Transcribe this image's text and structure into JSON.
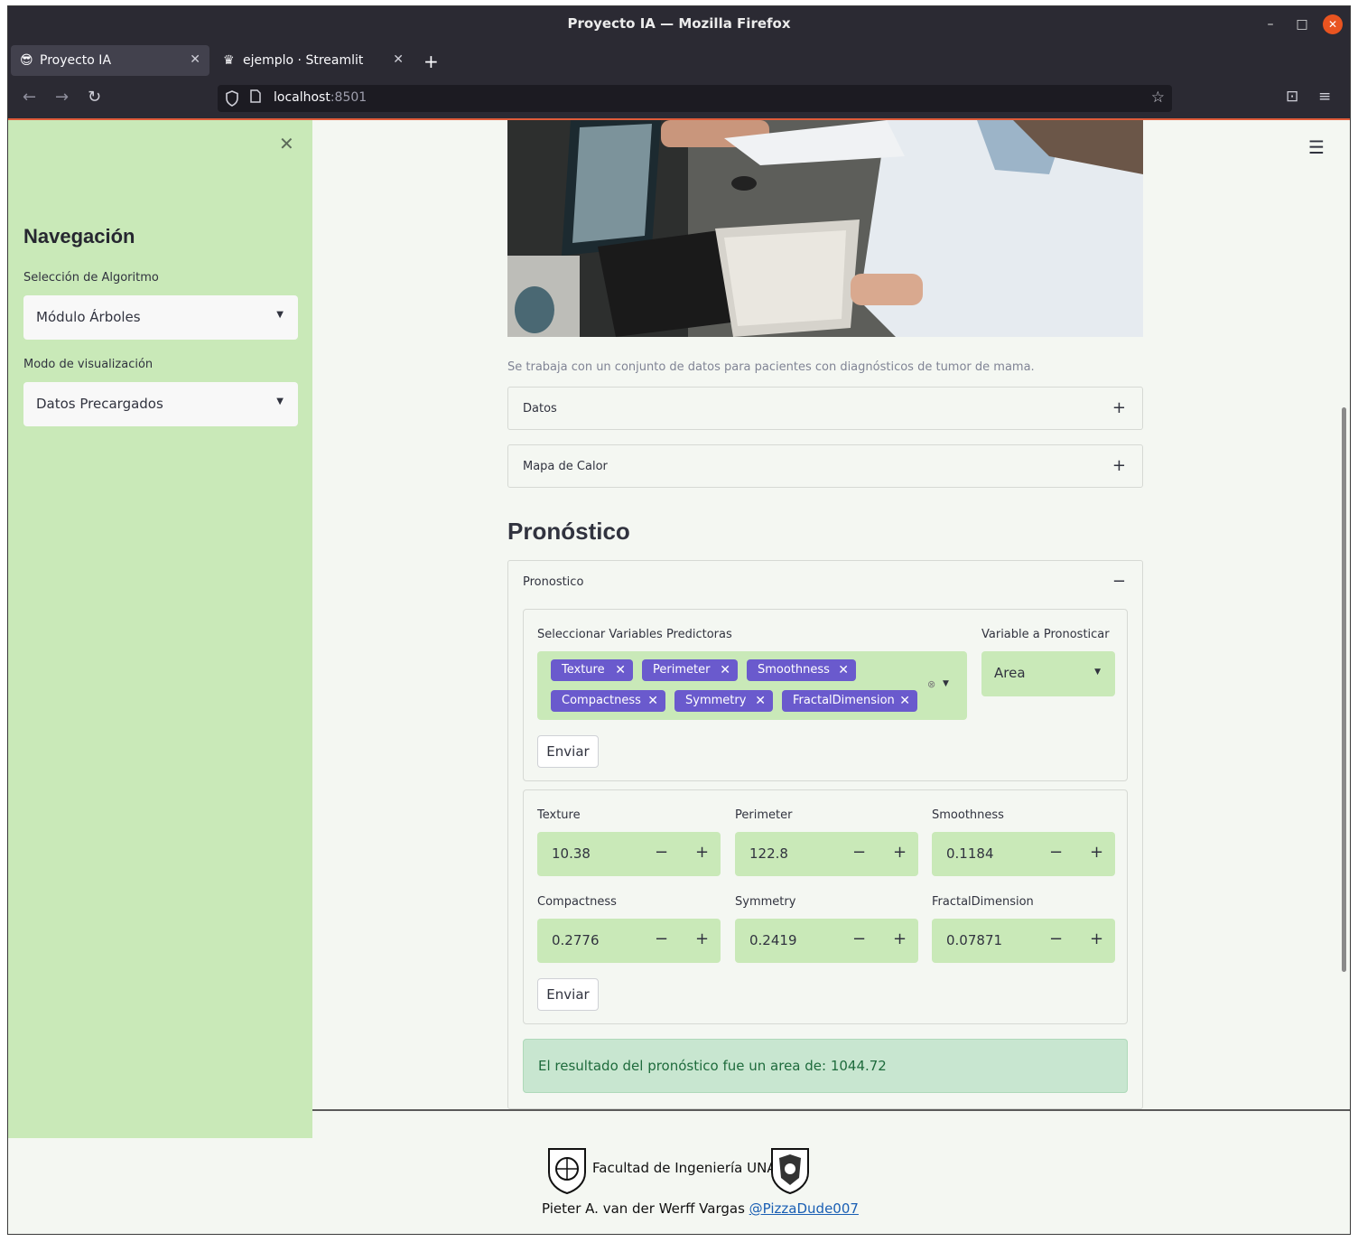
{
  "window": {
    "title": "Proyecto IA — Mozilla Firefox",
    "minimize": "–",
    "maximize": "□",
    "close": "✕"
  },
  "tabs": [
    {
      "icon": "😎",
      "label": "Proyecto IA",
      "close": "✕"
    },
    {
      "icon": "♛",
      "label": "ejemplo · Streamlit",
      "close": "✕"
    }
  ],
  "newtab": "+",
  "nav": {
    "back": "←",
    "forward": "→",
    "reload": "↻",
    "url_host": "localhost",
    "url_port": ":8501",
    "shield_icon": "shield-icon",
    "star": "☆",
    "pocket": "⊡",
    "menu": "≡"
  },
  "sidebar": {
    "close": "✕",
    "title": "Navegación",
    "algo_label": "Selección de Algoritmo",
    "algo_value": "Módulo Árboles",
    "mode_label": "Modo de visualización",
    "mode_value": "Datos Precargados",
    "caret": "▼"
  },
  "main": {
    "menu": "☰",
    "caption": "Se trabaja con un conjunto de datos para pacientes con diagnósticos de tumor de mama.",
    "expanders": [
      {
        "label": "Datos",
        "toggle": "+"
      },
      {
        "label": "Mapa de Calor",
        "toggle": "+"
      }
    ],
    "heading": "Pronóstico",
    "pron_expander": {
      "label": "Pronostico",
      "toggle": "−"
    },
    "predictors_label": "Seleccionar Variables Predictoras",
    "chips": [
      "Texture",
      "Perimeter",
      "Smoothness",
      "Compactness",
      "Symmetry",
      "FractalDimension"
    ],
    "chip_x": "✕",
    "clear_x": "⊗",
    "target_label": "Variable a Pronosticar",
    "target_value": "Area",
    "submit1": "Enviar",
    "inputs": [
      {
        "label": "Texture",
        "value": "10.38"
      },
      {
        "label": "Perimeter",
        "value": "122.8"
      },
      {
        "label": "Smoothness",
        "value": "0.1184"
      },
      {
        "label": "Compactness",
        "value": "0.2776"
      },
      {
        "label": "Symmetry",
        "value": "0.2419"
      },
      {
        "label": "FractalDimension",
        "value": "0.07871"
      }
    ],
    "minus": "−",
    "plus": "+",
    "submit2": "Enviar",
    "result": "El resultado del pronóstico fue un area de: 1044.72"
  },
  "footer": {
    "faculty": "Facultad de Ingeniería UNAM",
    "author": "Pieter A. van der Werff Vargas ",
    "handle": "@PizzaDude007"
  }
}
